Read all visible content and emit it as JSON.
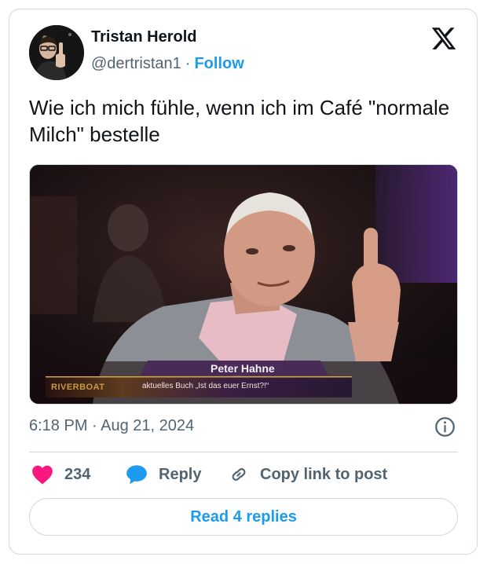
{
  "author": {
    "name": "Tristan Herold",
    "handle": "@dertristan1",
    "separator": "·",
    "follow_label": "Follow"
  },
  "tweet": {
    "text": "Wie ich mich fühle, wenn ich im Café \"normale Milch\" bestelle"
  },
  "media": {
    "lower_third_name": "Peter Hahne",
    "lower_third_subtitle": "aktuelles Buch „Ist das euer Ernst?!“",
    "show_logo": "RIVERBOAT"
  },
  "meta": {
    "timestamp": "6:18 PM · Aug 21, 2024"
  },
  "actions": {
    "like_count": "234",
    "reply_label": "Reply",
    "copy_label": "Copy link to post"
  },
  "read_replies_label": "Read 4 replies",
  "colors": {
    "accent": "#1d9bf0",
    "like": "#f91880",
    "text_primary": "#0f1419",
    "text_secondary": "#536471",
    "border": "#cfd9de"
  },
  "icons": {
    "brand": "x-logo-icon",
    "like": "heart-icon",
    "reply": "reply-bubble-icon",
    "copy": "link-icon",
    "info": "info-icon"
  }
}
